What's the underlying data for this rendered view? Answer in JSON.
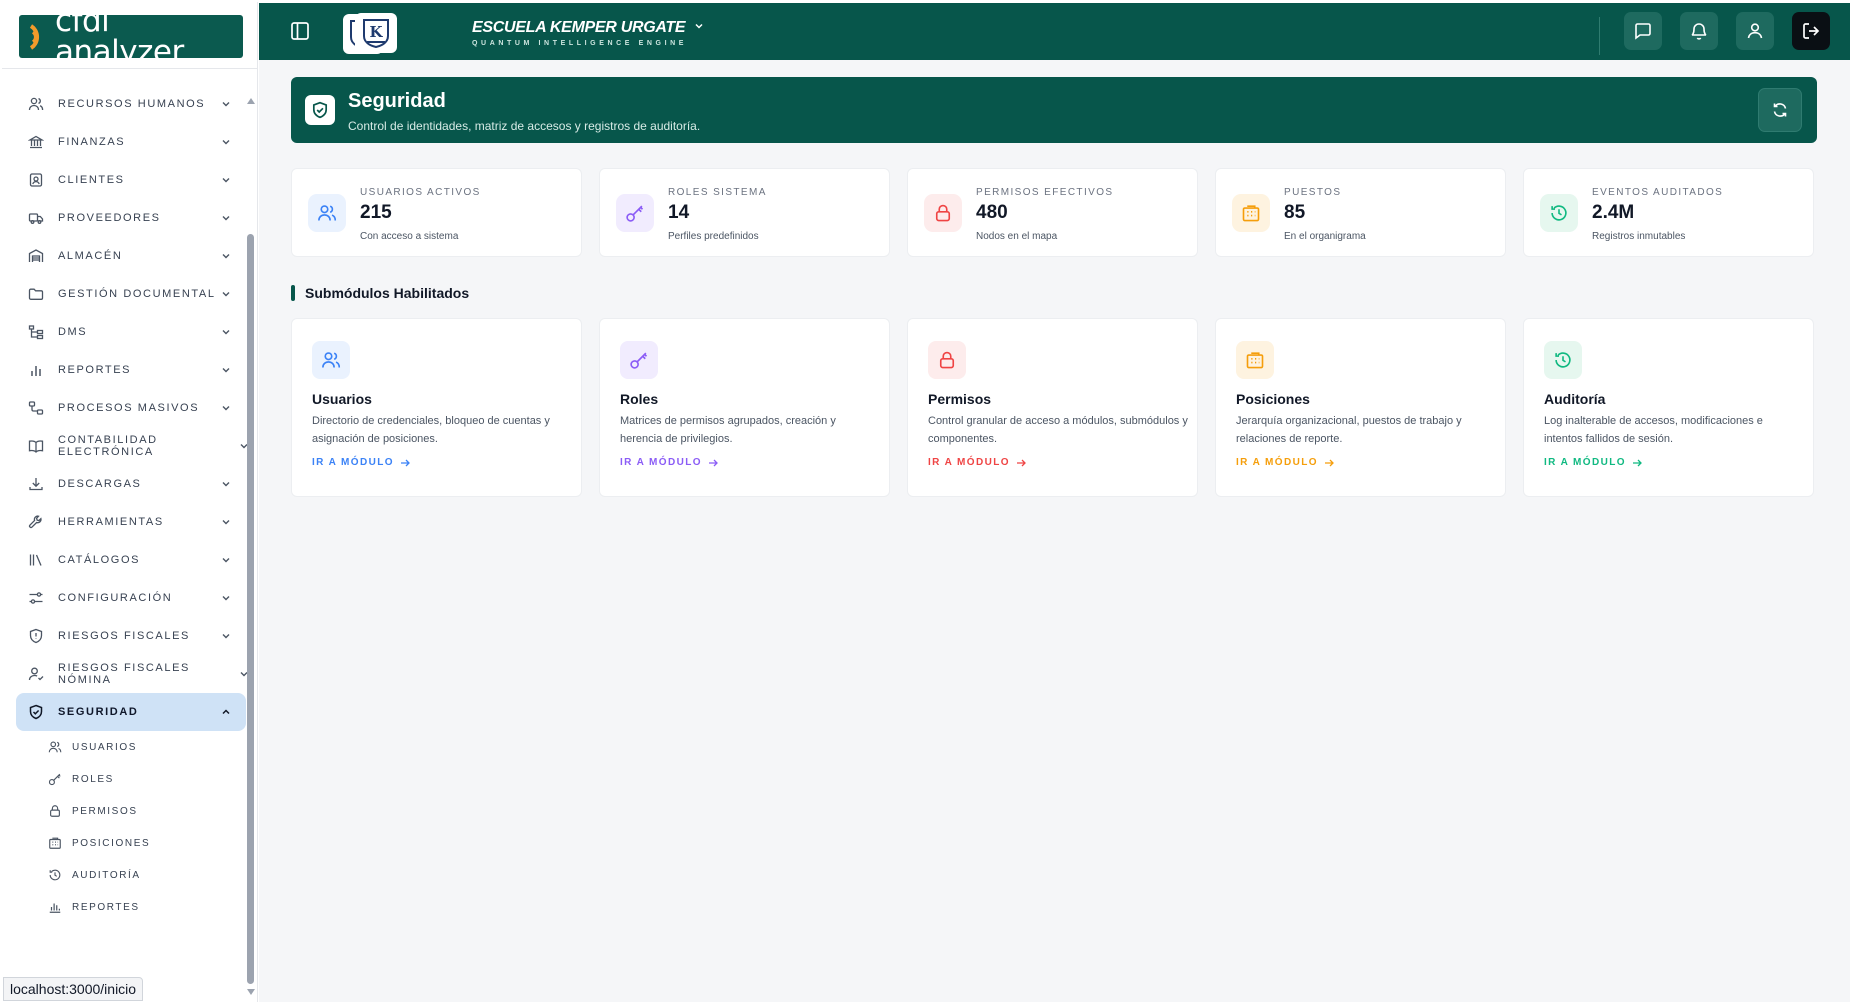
{
  "app": {
    "brand": "cfdi analyzer"
  },
  "header": {
    "school_name": "ESCUELA KEMPER URGATE",
    "school_tagline": "QUANTUM INTELLIGENCE ENGINE",
    "logo_letter": "K"
  },
  "sidebar": {
    "items": [
      {
        "label": "RECURSOS HUMANOS",
        "icon": "users-icon"
      },
      {
        "label": "FINANZAS",
        "icon": "bank-icon"
      },
      {
        "label": "CLIENTES",
        "icon": "contact-icon"
      },
      {
        "label": "PROVEEDORES",
        "icon": "truck-icon"
      },
      {
        "label": "ALMACÉN",
        "icon": "warehouse-icon"
      },
      {
        "label": "GESTIÓN DOCUMENTAL",
        "icon": "folder-icon"
      },
      {
        "label": "DMS",
        "icon": "tree-icon"
      },
      {
        "label": "REPORTES",
        "icon": "bar-chart-icon"
      },
      {
        "label": "PROCESOS MASIVOS",
        "icon": "workflow-icon"
      },
      {
        "label": "CONTABILIDAD ELECTRÓNICA",
        "icon": "book-icon"
      },
      {
        "label": "DESCARGAS",
        "icon": "download-icon"
      },
      {
        "label": "HERRAMIENTAS",
        "icon": "wrench-icon"
      },
      {
        "label": "CATÁLOGOS",
        "icon": "library-icon"
      },
      {
        "label": "CONFIGURACIÓN",
        "icon": "sliders-icon"
      },
      {
        "label": "RIESGOS FISCALES",
        "icon": "shield-alert-icon"
      },
      {
        "label": "RIESGOS FISCALES NÓMINA",
        "icon": "user-check-icon"
      },
      {
        "label": "SEGURIDAD",
        "icon": "shield-check-icon",
        "active": true
      }
    ],
    "sub_items": [
      {
        "label": "USUARIOS",
        "icon": "users-icon"
      },
      {
        "label": "ROLES",
        "icon": "key-icon"
      },
      {
        "label": "PERMISOS",
        "icon": "lock-icon"
      },
      {
        "label": "POSICIONES",
        "icon": "building-icon"
      },
      {
        "label": "AUDITORÍA",
        "icon": "history-icon"
      },
      {
        "label": "REPORTES",
        "icon": "bar-chart-icon"
      }
    ]
  },
  "status_bar": {
    "url": "localhost:3000/inicio"
  },
  "banner": {
    "title": "Seguridad",
    "subtitle": "Control de identidades, matriz de accesos y registros de auditoría."
  },
  "stats": [
    {
      "label": "USUARIOS ACTIVOS",
      "value": "215",
      "note": "Con acceso a sistema",
      "color": "#3b82f6",
      "bg": "#eaf2fe",
      "icon": "users-icon"
    },
    {
      "label": "ROLES SISTEMA",
      "value": "14",
      "note": "Perfiles predefinidos",
      "color": "#8b5cf6",
      "bg": "#f1ecfe",
      "icon": "key-icon"
    },
    {
      "label": "PERMISOS EFECTIVOS",
      "value": "480",
      "note": "Nodos en el mapa",
      "color": "#ef4444",
      "bg": "#fdecec",
      "icon": "lock-icon"
    },
    {
      "label": "PUESTOS",
      "value": "85",
      "note": "En el organigrama",
      "color": "#f59e0b",
      "bg": "#fef3e0",
      "icon": "building-icon"
    },
    {
      "label": "EVENTOS AUDITADOS",
      "value": "2.4M",
      "note": "Registros inmutables",
      "color": "#10b981",
      "bg": "#e6f7ef",
      "icon": "history-icon"
    }
  ],
  "section": {
    "title": "Submódulos Habilitados"
  },
  "cards": [
    {
      "title": "Usuarios",
      "desc": "Directorio de credenciales, bloqueo de cuentas y asignación de posiciones.",
      "link": "IR A MÓDULO",
      "color": "#3b82f6",
      "bg": "#eaf2fe",
      "icon": "users-icon"
    },
    {
      "title": "Roles",
      "desc": "Matrices de permisos agrupados, creación y herencia de privilegios.",
      "link": "IR A MÓDULO",
      "color": "#8b5cf6",
      "bg": "#f1ecfe",
      "icon": "key-icon"
    },
    {
      "title": "Permisos",
      "desc": "Control granular de acceso a módulos, submódulos y componentes.",
      "link": "IR A MÓDULO",
      "color": "#ef4444",
      "bg": "#fdecec",
      "icon": "lock-icon"
    },
    {
      "title": "Posiciones",
      "desc": "Jerarquía organizacional, puestos de trabajo y relaciones de reporte.",
      "link": "IR A MÓDULO",
      "color": "#f59e0b",
      "bg": "#fef3e0",
      "icon": "building-icon"
    },
    {
      "title": "Auditoría",
      "desc": "Log inalterable de accesos, modificaciones e intentos fallidos de sesión.",
      "link": "IR A MÓDULO",
      "color": "#10b981",
      "bg": "#e6f7ef",
      "icon": "history-icon"
    }
  ]
}
